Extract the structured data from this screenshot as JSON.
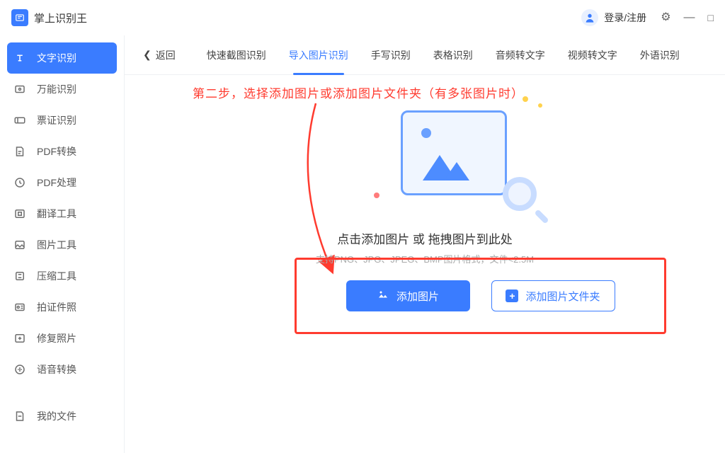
{
  "app": {
    "title": "掌上识别王"
  },
  "header": {
    "login_label": "登录/注册"
  },
  "sidebar": {
    "items": [
      {
        "label": "文字识别"
      },
      {
        "label": "万能识别"
      },
      {
        "label": "票证识别"
      },
      {
        "label": "PDF转换"
      },
      {
        "label": "PDF处理"
      },
      {
        "label": "翻译工具"
      },
      {
        "label": "图片工具"
      },
      {
        "label": "压缩工具"
      },
      {
        "label": "拍证件照"
      },
      {
        "label": "修复照片"
      },
      {
        "label": "语音转换"
      }
    ],
    "files_label": "我的文件"
  },
  "tabs": {
    "back_label": "返回",
    "items": [
      {
        "label": "快速截图识别"
      },
      {
        "label": "导入图片识别"
      },
      {
        "label": "手写识别"
      },
      {
        "label": "表格识别"
      },
      {
        "label": "音频转文字"
      },
      {
        "label": "视频转文字"
      },
      {
        "label": "外语识别"
      }
    ]
  },
  "content": {
    "annotation": "第二步，选择添加图片或添加图片文件夹（有多张图片时）",
    "hint_main": "点击添加图片 或 拖拽图片到此处",
    "hint_sub": "支持PNG、JPG、JPEG、BMP图片格式，文件<2.5M",
    "btn_add_image": "添加图片",
    "btn_add_folder": "添加图片文件夹"
  }
}
